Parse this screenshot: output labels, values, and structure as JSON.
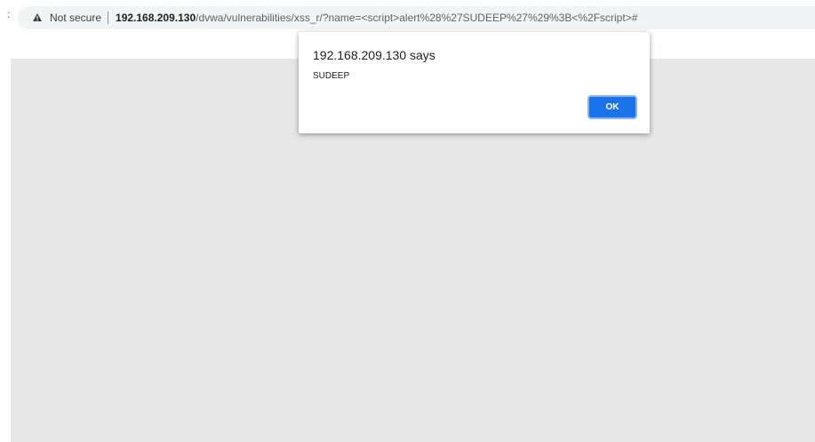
{
  "browser": {
    "left_marker": ":",
    "security_icon": "warning-icon",
    "security_label": "Not secure",
    "url": {
      "host": "192.168.209.130",
      "path": "/dvwa/vulnerabilities/xss_r/?name=<script>alert%28%27SUDEEP%27%29%3B<%2Fscript>#"
    }
  },
  "dialog": {
    "title": "192.168.209.130 says",
    "message": "SUDEEP",
    "ok_label": "OK"
  },
  "colors": {
    "content_background": "#e7e7e7",
    "accent": "#1a73e8",
    "focus_ring": "#8ab4f8"
  }
}
